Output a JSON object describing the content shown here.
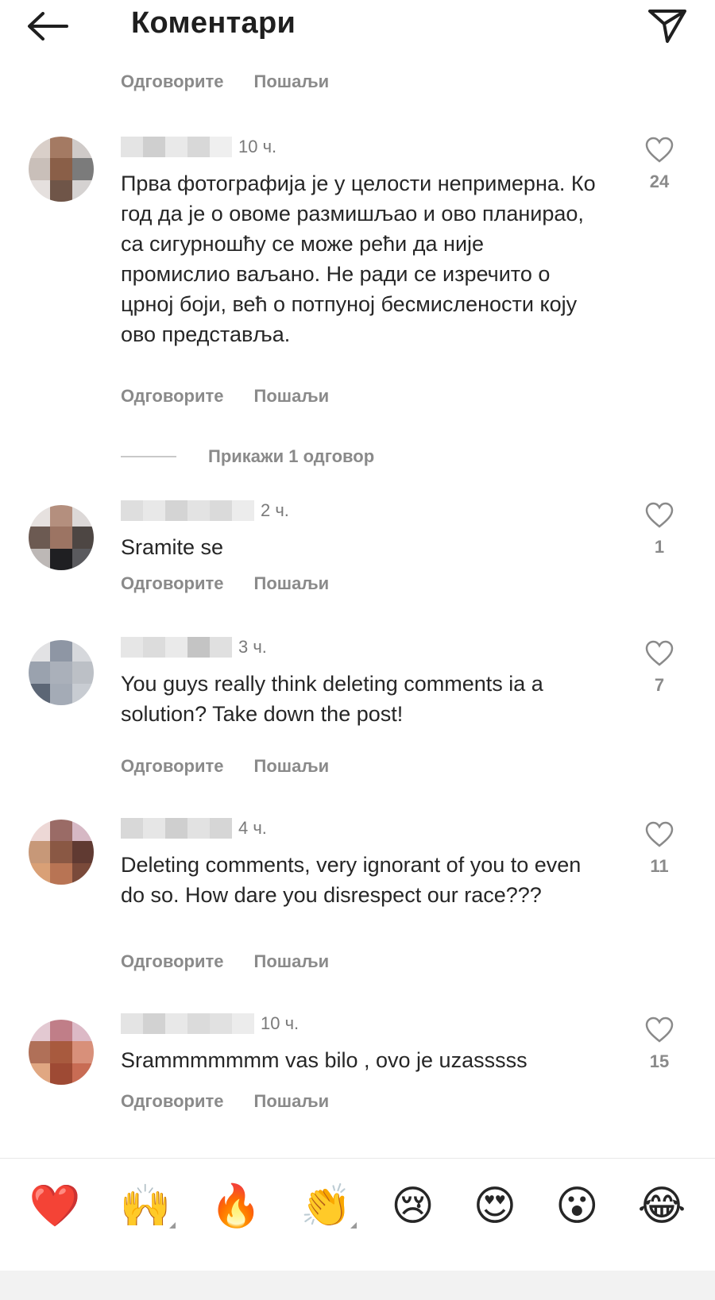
{
  "header": {
    "title": "Коментари"
  },
  "actions": {
    "reply": "Одговорите",
    "send": "Пошаљи"
  },
  "view_replies": "Прикажи 1 одговор",
  "comments": [
    {
      "time": "10 ч.",
      "text": "Прва фотографија је у целости непримерна. Ко год да је о овоме размишљао и ово планирао, са сигурношћу се може рећи да није промислио ваљано. Не ради се изречито о црној боји, већ о потпуној бесмислености коју ово представља.",
      "likes": "24"
    },
    {
      "time": "2 ч.",
      "text": "Sramite se",
      "likes": "1"
    },
    {
      "time": "3 ч.",
      "text": "You guys really think deleting comments ia a solution? Take down the post!",
      "likes": "7"
    },
    {
      "time": "4 ч.",
      "text": "Deleting comments, very ignorant of you to even do so. How dare you disrespect our race???",
      "likes": "11"
    },
    {
      "time": "10 ч.",
      "text": "Srammmmmmm vas bilo , ovo je uzasssss",
      "likes": "15"
    }
  ],
  "emoji_bar": [
    "❤️",
    "🙌",
    "🔥",
    "👏",
    "😢",
    "😍",
    "😮",
    "😂"
  ],
  "colors": {
    "heart": "#e0242f",
    "muted": "#8a8a8a"
  }
}
